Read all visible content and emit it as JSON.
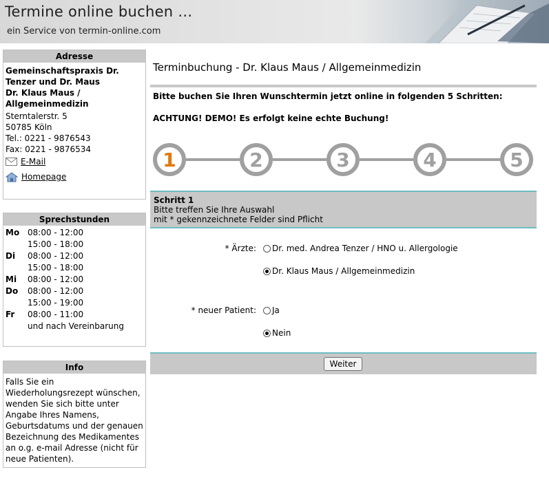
{
  "header": {
    "title": "Termine online buchen ...",
    "subtitle": "ein Service von termin-online.com"
  },
  "address": {
    "heading": "Adresse",
    "practice_name": "Gemeinschaftspraxis Dr. Tenzer und Dr. Maus",
    "doctor": "Dr. Klaus Maus / Allgemeinmedizin",
    "street": "Sterntalerstr. 5",
    "city": "50785 Köln",
    "phone": "Tel.: 0221 - 9876543",
    "fax": "Fax: 0221 - 9876534",
    "email_label": "E-Mail",
    "homepage_label": "Homepage"
  },
  "hours": {
    "heading": "Sprechstunden",
    "days": [
      {
        "day": "Mo",
        "times": [
          "08:00 - 12:00",
          "15:00 - 18:00"
        ]
      },
      {
        "day": "Di",
        "times": [
          "08:00 - 12:00",
          "15:00 - 18:00"
        ]
      },
      {
        "day": "Mi",
        "times": [
          "08:00 - 12:00"
        ]
      },
      {
        "day": "Do",
        "times": [
          "08:00 - 12:00",
          "15:00 - 19:00"
        ]
      },
      {
        "day": "Fr",
        "times": [
          "08:00 - 11:00",
          "und nach Vereinbarung"
        ]
      }
    ]
  },
  "info": {
    "heading": "Info",
    "text": "Falls Sie ein Wiederholungsrezept wünschen, wenden Sie sich bitte unter Angabe Ihres Namens, Geburtsdatums und der genauen Bezeichnung des Medikamentes an o.g. e-mail Adresse (nicht für neue Patienten)."
  },
  "main": {
    "title": "Terminbuchung - Dr. Klaus Maus / Allgemeinmedizin",
    "intro": "Bitte buchen Sie Ihren Wunschtermin jetzt online in folgenden 5 Schritten:",
    "demo_notice": "ACHTUNG! DEMO! Es erfolgt keine echte Buchung!",
    "steps": [
      "1",
      "2",
      "3",
      "4",
      "5"
    ],
    "active_step": 1,
    "step_panel": {
      "title": "Schritt 1",
      "line1": "Bitte treffen Sie Ihre Auswahl",
      "line2": "mit * gekennzeichnete Felder sind Pflicht"
    },
    "form": {
      "doctors_label": "* Ärzte:",
      "doctor_options": [
        {
          "label": "Dr. med. Andrea Tenzer / HNO u. Allergologie",
          "checked": false
        },
        {
          "label": "Dr. Klaus Maus / Allgemeinmedizin",
          "checked": true
        }
      ],
      "new_patient_label": "* neuer Patient:",
      "new_patient_options": [
        {
          "label": "Ja",
          "checked": false
        },
        {
          "label": "Nein",
          "checked": true
        }
      ]
    },
    "next_button": "Weiter"
  },
  "colors": {
    "active_step": "#e07a10",
    "step_ring": "#a0a0a0",
    "panel_gray": "#c8c8c8",
    "teal_rule": "#6cbcc0"
  }
}
